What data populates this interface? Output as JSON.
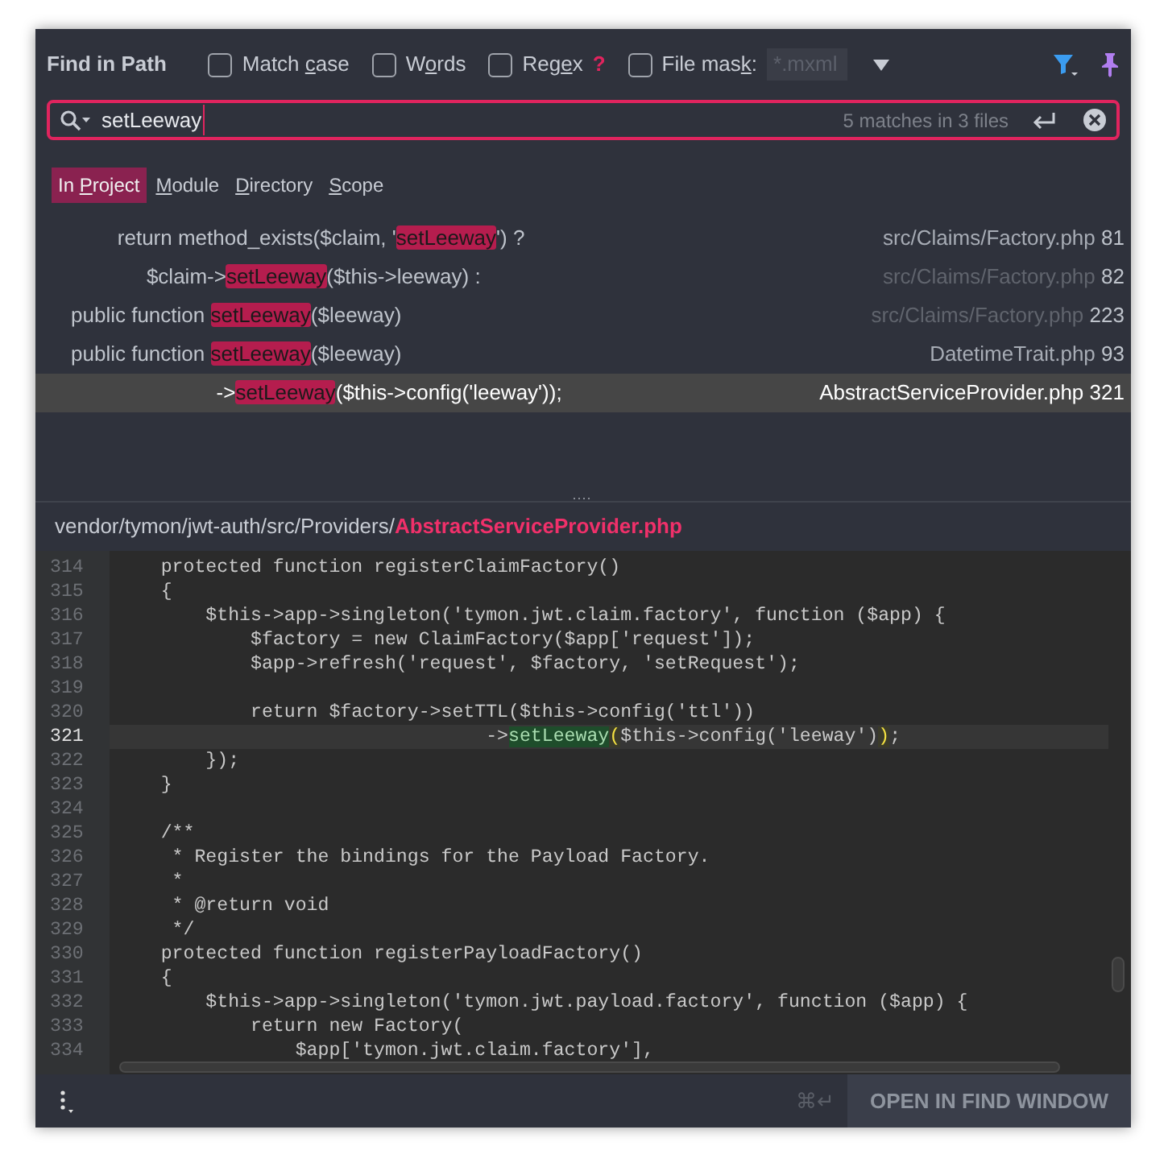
{
  "header": {
    "title": "Find in Path",
    "options": [
      {
        "lead": "Match ",
        "key": "c",
        "rest": "ase",
        "checked": false
      },
      {
        "lead": "W",
        "key": "o",
        "rest": "rds",
        "checked": false
      },
      {
        "lead": "Reg",
        "key": "e",
        "rest": "x",
        "checked": false,
        "help_text": "?"
      },
      {
        "lead": "File mas",
        "key": "k",
        "rest": ":",
        "checked": false,
        "placeholder": "*.mxml"
      }
    ]
  },
  "search": {
    "value": "setLeeway",
    "summary": "5 matches in 3 files"
  },
  "scopes": [
    {
      "lead": "In ",
      "key": "P",
      "rest": "roject",
      "selected": true
    },
    {
      "key": "M",
      "rest": "odule",
      "selected": false
    },
    {
      "key": "D",
      "rest": "irectory",
      "selected": false
    },
    {
      "key": "S",
      "rest": "cope",
      "selected": false
    }
  ],
  "results": [
    {
      "before": "        return method_exists($claim, '",
      "match": "setLeeway",
      "after": "') ?",
      "path": "src/Claims/Factory.php",
      "line": "81",
      "dimmed": false,
      "selected": false
    },
    {
      "before": "             $claim->",
      "match": "setLeeway",
      "after": "($this->leeway) :",
      "path": "src/Claims/Factory.php",
      "line": "82",
      "dimmed": true,
      "selected": false
    },
    {
      "before": "public function ",
      "match": "setLeeway",
      "after": "($leeway)",
      "path": "src/Claims/Factory.php",
      "line": "223",
      "dimmed": true,
      "selected": false
    },
    {
      "before": "public function ",
      "match": "setLeeway",
      "after": "($leeway)",
      "path": "DatetimeTrait.php",
      "line": "93",
      "dimmed": false,
      "selected": false
    },
    {
      "before": "                         ->",
      "match": "setLeeway",
      "after": "($this->config('leeway'));",
      "path": "AbstractServiceProvider.php",
      "line": "321",
      "dimmed": false,
      "selected": true
    }
  ],
  "preview": {
    "dir": "vendor/tymon/jwt-auth/src/Providers/",
    "file": "AbstractServiceProvider.php",
    "lines": [
      {
        "num": "314",
        "current": false,
        "parts": [
          {
            "kind": "plain",
            "text": "    protected function registerClaimFactory()"
          }
        ]
      },
      {
        "num": "315",
        "current": false,
        "parts": [
          {
            "kind": "plain",
            "text": "    {"
          }
        ]
      },
      {
        "num": "316",
        "current": false,
        "parts": [
          {
            "kind": "plain",
            "text": "        $this->app->singleton('tymon.jwt.claim.factory', function ($app) {"
          }
        ]
      },
      {
        "num": "317",
        "current": false,
        "parts": [
          {
            "kind": "plain",
            "text": "            $factory = new ClaimFactory($app['request']);"
          }
        ]
      },
      {
        "num": "318",
        "current": false,
        "parts": [
          {
            "kind": "plain",
            "text": "            $app->refresh('request', $factory, 'setRequest');"
          }
        ]
      },
      {
        "num": "319",
        "current": false
      },
      {
        "num": "320",
        "current": false,
        "parts": [
          {
            "kind": "plain",
            "text": "            return $factory->setTTL($this->config('ttl'))"
          }
        ]
      },
      {
        "num": "321",
        "current": true,
        "parts": [
          {
            "kind": "plain",
            "text": "                                 ->"
          },
          {
            "kind": "match",
            "text": "setLeeway"
          },
          {
            "kind": "brace",
            "text": "("
          },
          {
            "kind": "plain",
            "text": "$this->config('leeway')"
          },
          {
            "kind": "brace",
            "text": ")"
          },
          {
            "kind": "plain",
            "text": ";"
          }
        ]
      },
      {
        "num": "322",
        "current": false,
        "parts": [
          {
            "kind": "plain",
            "text": "        });"
          }
        ]
      },
      {
        "num": "323",
        "current": false,
        "parts": [
          {
            "kind": "plain",
            "text": "    }"
          }
        ]
      },
      {
        "num": "324",
        "current": false
      },
      {
        "num": "325",
        "current": false,
        "parts": [
          {
            "kind": "plain",
            "text": "    /**"
          }
        ]
      },
      {
        "num": "326",
        "current": false,
        "parts": [
          {
            "kind": "plain",
            "text": "     * Register the bindings for the Payload Factory."
          }
        ]
      },
      {
        "num": "327",
        "current": false,
        "parts": [
          {
            "kind": "plain",
            "text": "     *"
          }
        ]
      },
      {
        "num": "328",
        "current": false,
        "parts": [
          {
            "kind": "plain",
            "text": "     * @return void"
          }
        ]
      },
      {
        "num": "329",
        "current": false,
        "parts": [
          {
            "kind": "plain",
            "text": "     */"
          }
        ]
      },
      {
        "num": "330",
        "current": false,
        "parts": [
          {
            "kind": "plain",
            "text": "    protected function registerPayloadFactory()"
          }
        ]
      },
      {
        "num": "331",
        "current": false,
        "parts": [
          {
            "kind": "plain",
            "text": "    {"
          }
        ]
      },
      {
        "num": "332",
        "current": false,
        "parts": [
          {
            "kind": "plain",
            "text": "        $this->app->singleton('tymon.jwt.payload.factory', function ($app) {"
          }
        ]
      },
      {
        "num": "333",
        "current": false,
        "parts": [
          {
            "kind": "plain",
            "text": "            return new Factory("
          }
        ]
      },
      {
        "num": "334",
        "current": false,
        "parts": [
          {
            "kind": "plain",
            "text": "                $app['tymon.jwt.claim.factory'],"
          }
        ]
      }
    ]
  },
  "footer": {
    "shortcut": "⌘↵",
    "button": "OPEN IN FIND WINDOW"
  }
}
